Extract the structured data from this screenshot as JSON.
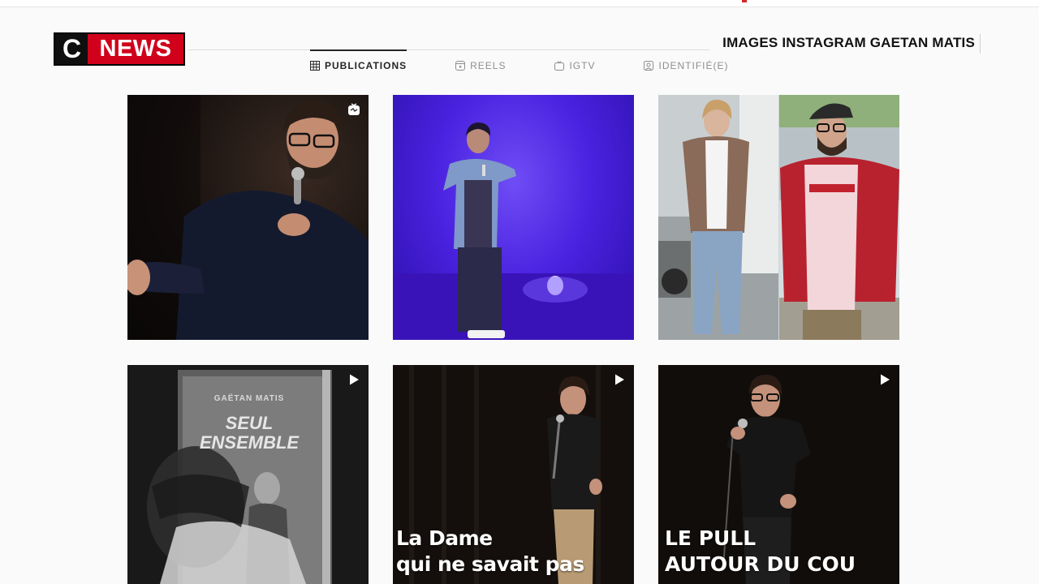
{
  "broadcast": {
    "logo_c": "C",
    "logo_news": "NEWS",
    "banner_title": "IMAGES INSTAGRAM GAETAN MATIS"
  },
  "tabs": [
    {
      "label": "PUBLICATIONS",
      "icon": "grid-icon",
      "active": true
    },
    {
      "label": "REELS",
      "icon": "reels-icon",
      "active": false
    },
    {
      "label": "IGTV",
      "icon": "igtv-icon",
      "active": false
    },
    {
      "label": "IDENTIFIÉ(E)",
      "icon": "tagged-icon",
      "active": false
    }
  ],
  "posts": [
    {
      "overlay_icon": "igtv-icon",
      "caption_line1": "",
      "caption_line2": "",
      "poster_name": "",
      "poster_title_line1": "",
      "poster_title_line2": ""
    },
    {
      "overlay_icon": "",
      "caption_line1": "",
      "caption_line2": "",
      "poster_name": "",
      "poster_title_line1": "",
      "poster_title_line2": ""
    },
    {
      "overlay_icon": "",
      "caption_line1": "",
      "caption_line2": "",
      "poster_name": "",
      "poster_title_line1": "",
      "poster_title_line2": ""
    },
    {
      "overlay_icon": "play-icon",
      "caption_line1": "",
      "caption_line2": "",
      "poster_name": "GAËTAN MATIS",
      "poster_title_line1": "SEUL",
      "poster_title_line2": "ENSEMBLE"
    },
    {
      "overlay_icon": "play-icon",
      "caption_line1": "La Dame",
      "caption_line2": "qui ne savait pas",
      "poster_name": "",
      "poster_title_line1": "",
      "poster_title_line2": ""
    },
    {
      "overlay_icon": "play-icon",
      "caption_line1": "LE PULL",
      "caption_line2": "AUTOUR DU COU",
      "poster_name": "",
      "poster_title_line1": "",
      "poster_title_line2": ""
    }
  ],
  "colors": {
    "brand_red": "#d0021b",
    "tab_active": "#262626",
    "tab_inactive": "#8e8e8e"
  }
}
